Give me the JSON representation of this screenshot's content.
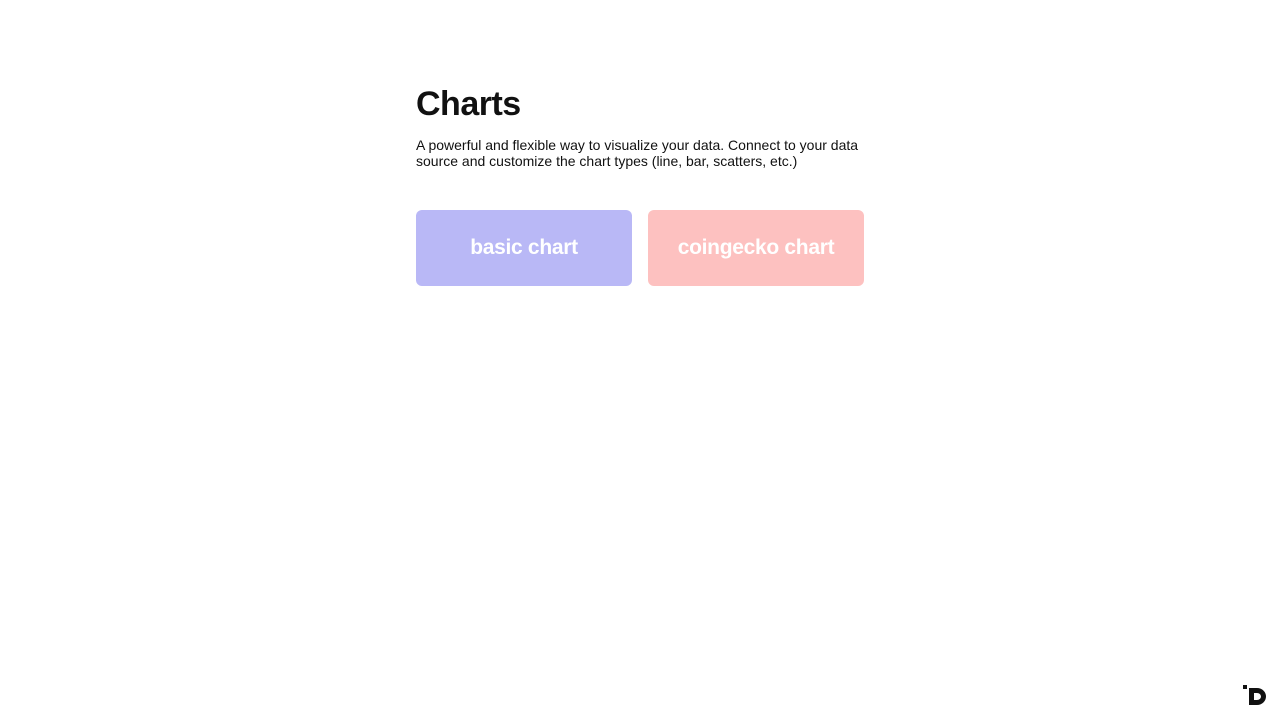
{
  "page": {
    "title": "Charts",
    "description": "A powerful and flexible way to visualize your data. Connect to your data source and customize the chart types (line, bar, scatters, etc.)"
  },
  "cards": [
    {
      "label": "basic chart",
      "color": "#b9b8f6"
    },
    {
      "label": "coingecko chart",
      "color": "#fdc1c0"
    }
  ],
  "footer": {
    "logo_icon": "brand-logo-icon"
  }
}
